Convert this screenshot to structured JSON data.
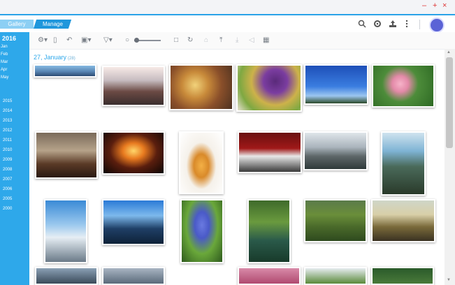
{
  "window": {
    "minimize": "–",
    "maximize": "+",
    "close": "×"
  },
  "tabs": {
    "gallery": "Gallery",
    "manage": "Manage"
  },
  "header": {
    "search_icon": "search-icon",
    "settings_icon": "gear-icon",
    "upload_icon": "upload-icon",
    "more_icon": "more-vertical-icon"
  },
  "sidebar": {
    "current_year": "2016",
    "months": [
      "Jan",
      "Feb",
      "Mar",
      "Apr",
      "May"
    ],
    "years": [
      "2015",
      "2014",
      "2013",
      "2012",
      "2011",
      "2010",
      "2009",
      "2008",
      "2007",
      "2006",
      "2005",
      "2000"
    ]
  },
  "toolbar": {
    "items": [
      "⚙▾",
      "▯",
      "↶",
      "▣▾",
      "▽▾",
      "○",
      "□",
      "↻",
      "⌂",
      "⤒",
      "⤓",
      "◁",
      "▦"
    ]
  },
  "content": {
    "date": "27, January",
    "count": "(28)"
  },
  "colors": {
    "accent": "#2ea8ea",
    "tab_active": "#1f97dc",
    "close": "#dd3333"
  }
}
